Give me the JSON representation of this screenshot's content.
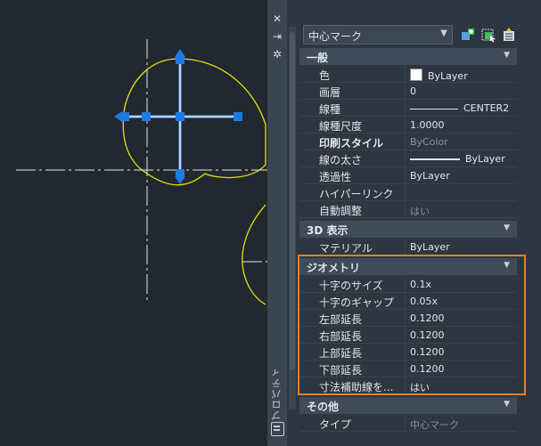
{
  "palette": {
    "title": "プロパティ",
    "object_selector": "中心マーク",
    "sections": {
      "general": {
        "label": "一般",
        "rows": [
          {
            "name": "色",
            "value": "ByLayer"
          },
          {
            "name": "画層",
            "value": "0"
          },
          {
            "name": "線種",
            "value": "CENTER2"
          },
          {
            "name": "線種尺度",
            "value": "1.0000"
          },
          {
            "name": "印刷スタイル",
            "value": "ByColor"
          },
          {
            "name": "線の太さ",
            "value": "ByLayer"
          },
          {
            "name": "透過性",
            "value": "ByLayer"
          },
          {
            "name": "ハイパーリンク",
            "value": ""
          },
          {
            "name": "自動調整",
            "value": "はい"
          }
        ]
      },
      "view3d": {
        "label": "3D 表示",
        "rows": [
          {
            "name": "マテリアル",
            "value": "ByLayer"
          }
        ]
      },
      "geometry": {
        "label": "ジオメトリ",
        "rows": [
          {
            "name": "十字のサイズ",
            "value": "0.1x"
          },
          {
            "name": "十字のギャップ",
            "value": "0.05x"
          },
          {
            "name": "左部延長",
            "value": "0.1200"
          },
          {
            "name": "右部延長",
            "value": "0.1200"
          },
          {
            "name": "上部延長",
            "value": "0.1200"
          },
          {
            "name": "下部延長",
            "value": "0.1200"
          },
          {
            "name": "寸法補助線を...",
            "value": "はい"
          }
        ]
      },
      "misc": {
        "label": "その他",
        "rows": [
          {
            "name": "タイプ",
            "value": "中心マーク"
          }
        ]
      }
    }
  },
  "colors": {
    "background": "#212830",
    "palette_bg": "#2d3641",
    "curve": "#e6e600",
    "grip": "#1f7ae0",
    "highlight": "#e8821c"
  }
}
